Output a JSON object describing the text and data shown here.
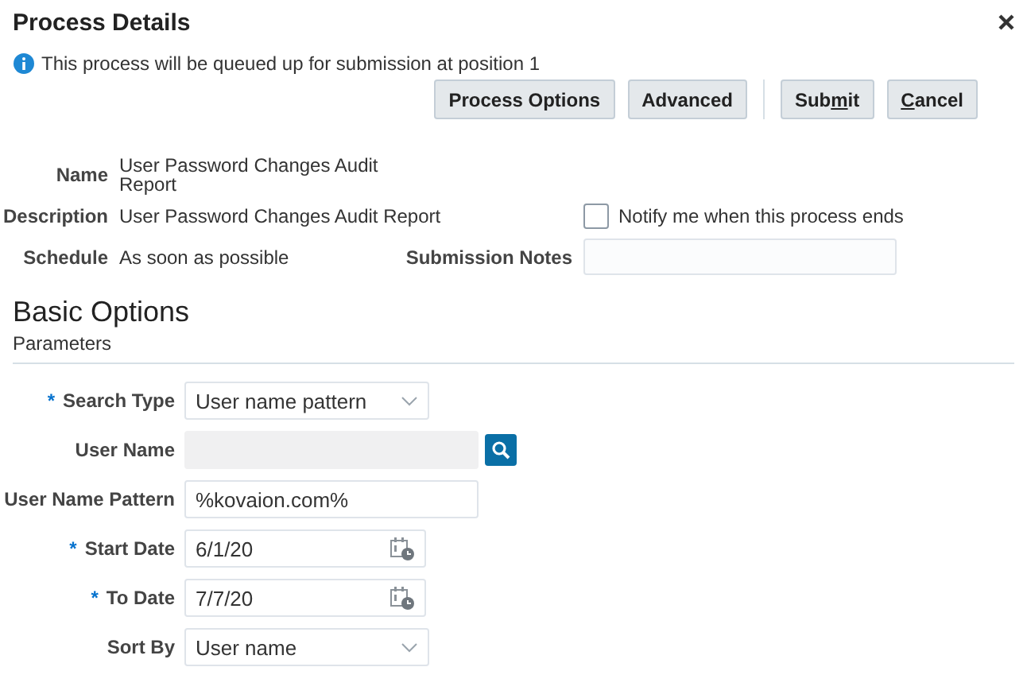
{
  "dialog": {
    "title": "Process Details"
  },
  "info": "This process will be queued up for submission at position 1",
  "button_groups": [
    {
      "buttons": [
        {
          "label": [
            {
              "text": "Process Options",
              "underline": false
            }
          ]
        },
        {
          "label": [
            {
              "text": "Advanced",
              "underline": false
            }
          ]
        }
      ]
    },
    {
      "buttons": [
        {
          "label": [
            {
              "text": "Sub",
              "underline": false
            },
            {
              "text": "m",
              "underline": true
            },
            {
              "text": "it",
              "underline": false
            }
          ]
        },
        {
          "label": [
            {
              "text": "C",
              "underline": true
            },
            {
              "text": "ancel",
              "underline": false
            }
          ]
        }
      ]
    }
  ],
  "details": {
    "name": {
      "label": "Name",
      "value": "User Password Changes Audit Report"
    },
    "description": {
      "label": "Description",
      "value": "User Password Changes Audit Report"
    },
    "schedule": {
      "label": "Schedule",
      "value": "As soon as possible"
    },
    "notify": {
      "label": "Notify me when this process ends",
      "checked": false
    },
    "submission_notes": {
      "label": "Submission Notes"
    }
  },
  "section": {
    "title": "Basic Options",
    "subtitle": "Parameters"
  },
  "parameters": [
    {
      "kind": "select",
      "label": "Search Type",
      "required_mark": "*",
      "disabled": false,
      "value": "User name pattern"
    },
    {
      "kind": "lookup",
      "label": "User Name",
      "disabled": true
    },
    {
      "kind": "text",
      "label": "User Name Pattern",
      "disabled": false,
      "value": "%kovaion.com%"
    },
    {
      "kind": "date",
      "label": "Start Date",
      "required_mark": "*",
      "disabled": false,
      "value": "6/1/20"
    },
    {
      "kind": "date",
      "label": "To Date",
      "required_mark": "*",
      "disabled": false,
      "value": "7/7/20"
    },
    {
      "kind": "select",
      "label": "Sort By",
      "disabled": false,
      "value": "User name"
    }
  ]
}
